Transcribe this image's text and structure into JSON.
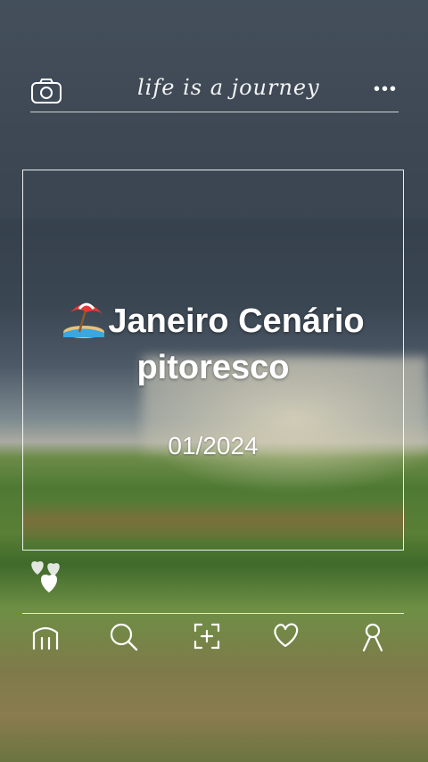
{
  "header": {
    "script_title": "life is a journey",
    "icons": {
      "left": "camera-icon",
      "right": "more-dots-icon"
    },
    "more_label": "•••"
  },
  "card": {
    "emoji_name": "beach-umbrella-emoji",
    "title_line1": "Janeiro Cenário",
    "title_line2": "pitoresco",
    "date": "01/2024"
  },
  "reactions": {
    "icon": "hearts-icon"
  },
  "bottom_nav": [
    {
      "icon": "home-icon"
    },
    {
      "icon": "search-icon"
    },
    {
      "icon": "add-photo-icon"
    },
    {
      "icon": "heart-icon"
    },
    {
      "icon": "profile-icon"
    }
  ],
  "colors": {
    "overlay_line": "#ffffff",
    "text": "#ffffff"
  }
}
